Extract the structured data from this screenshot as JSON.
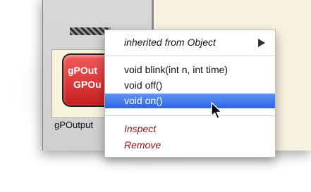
{
  "object": {
    "chip_line1": "gPOut",
    "chip_line2": "GPOu",
    "caption": "gPOutput"
  },
  "context_menu": {
    "inherited_label": "inherited from Object",
    "items": [
      {
        "label": "void blink(int n, int time)"
      },
      {
        "label": "void off()"
      },
      {
        "label": "void on()",
        "selected": true
      }
    ],
    "inspect_label": "Inspect",
    "remove_label": "Remove"
  },
  "colors": {
    "highlight": "#3d74ea",
    "object_red": "#e23b3b",
    "action_text": "#8c1212"
  },
  "icons": [
    "submenu-arrow-icon",
    "mouse-pointer-icon"
  ]
}
